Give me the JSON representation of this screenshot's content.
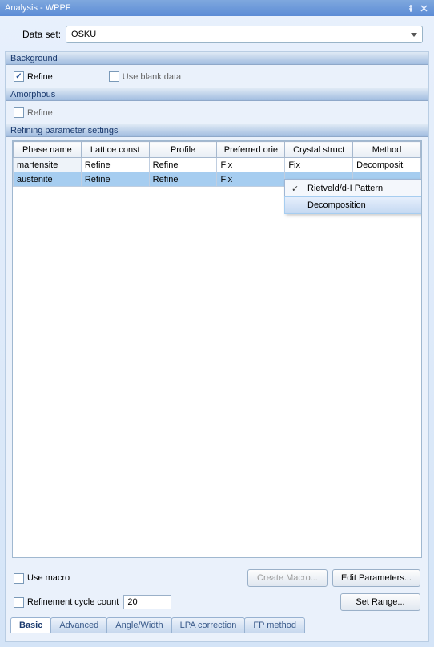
{
  "window": {
    "title": "Analysis - WPPF"
  },
  "dataset": {
    "label": "Data set:",
    "value": "OSKU"
  },
  "sections": {
    "background": {
      "title": "Background",
      "refine_label": "Refine",
      "refine_checked": true,
      "blank_label": "Use blank data",
      "blank_checked": false
    },
    "amorphous": {
      "title": "Amorphous",
      "refine_label": "Refine",
      "refine_checked": false
    },
    "refining": {
      "title": "Refining parameter settings"
    }
  },
  "table": {
    "headers": [
      "Phase name",
      "Lattice const",
      "Profile",
      "Preferred orie",
      "Crystal struct",
      "Method"
    ],
    "rows": [
      {
        "cells": [
          "martensite",
          "Refine",
          "Refine",
          "Fix",
          "Fix",
          "Decompositi"
        ],
        "selected": false
      },
      {
        "cells": [
          "austenite",
          "Refine",
          "Refine",
          "Fix",
          "",
          ""
        ],
        "selected": true
      }
    ]
  },
  "context_menu": {
    "items": [
      {
        "label": "Rietveld/d-I Pattern",
        "checked": true,
        "hover": false
      },
      {
        "label": "Decomposition",
        "checked": false,
        "hover": true
      }
    ]
  },
  "bottom": {
    "use_macro_label": "Use macro",
    "create_macro": "Create Macro...",
    "edit_params": "Edit Parameters...",
    "refinement_label": "Refinement cycle count",
    "refinement_value": "20",
    "set_range": "Set Range..."
  },
  "tabs": [
    "Basic",
    "Advanced",
    "Angle/Width",
    "LPA correction",
    "FP method"
  ],
  "active_tab": 0
}
